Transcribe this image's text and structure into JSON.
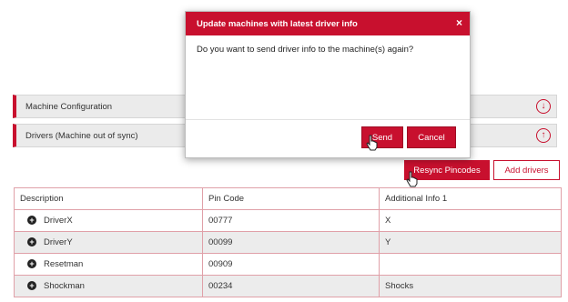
{
  "colors": {
    "accent": "#c8102e",
    "bar_bg": "#ebebeb",
    "row_alt": "#ececec"
  },
  "panels": {
    "config": {
      "label": "Machine Configuration",
      "icon": "arrow-down-circle-icon"
    },
    "drivers": {
      "label": "Drivers (Machine out of sync)",
      "icon": "arrow-up-circle-icon"
    }
  },
  "toolbar": {
    "resync_label": "Resync Pincodes",
    "add_label": "Add drivers"
  },
  "table": {
    "headers": [
      "Description",
      "Pin Code",
      "Additional Info 1"
    ],
    "rows": [
      {
        "description": "DriverX",
        "pin": "00777",
        "info": "X"
      },
      {
        "description": "DriverY",
        "pin": "00099",
        "info": "Y"
      },
      {
        "description": "Resetman",
        "pin": "00909",
        "info": ""
      },
      {
        "description": "Shockman",
        "pin": "00234",
        "info": "Shocks"
      }
    ]
  },
  "modal": {
    "title": "Update machines with latest driver info",
    "close": "×",
    "message": "Do you want to send driver info to the machine(s) again?",
    "send_label": "Send",
    "cancel_label": "Cancel"
  }
}
